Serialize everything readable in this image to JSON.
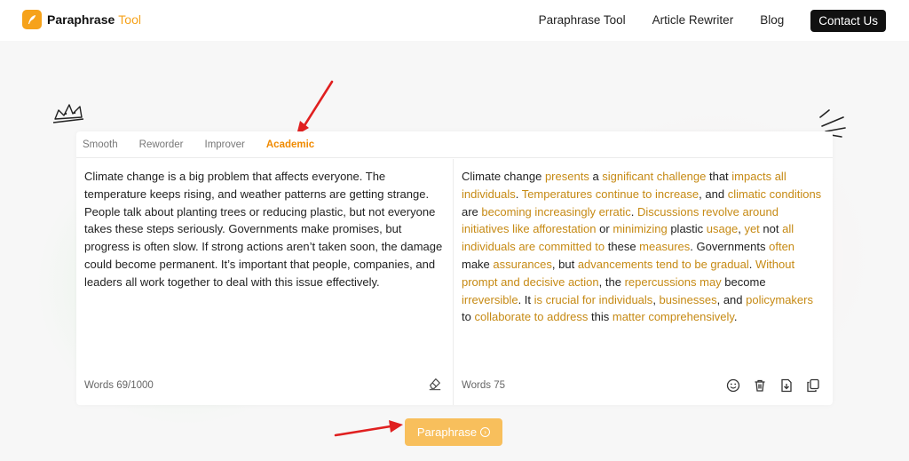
{
  "header": {
    "logo_icon": "feather-pen-icon",
    "logo_name": "Paraphrase",
    "logo_accent": "Tool",
    "nav": [
      "Paraphrase Tool",
      "Article Rewriter",
      "Blog"
    ],
    "contact_label": "Contact Us"
  },
  "tabs": [
    {
      "label": "Smooth",
      "active": false
    },
    {
      "label": "Reworder",
      "active": false
    },
    {
      "label": "Improver",
      "active": false
    },
    {
      "label": "Academic",
      "active": true
    }
  ],
  "input": {
    "text": "Climate change is a big problem that affects everyone. The temperature keeps rising, and weather patterns are getting strange. People talk about planting trees or reducing plastic, but not everyone takes these steps seriously. Governments make promises, but progress is often slow. If strong actions aren’t taken soon, the damage could become permanent. It’s important that people, companies, and leaders all work together to deal with this issue effectively.",
    "word_count": "Words 69/1000"
  },
  "output": {
    "segments": [
      {
        "t": "Climate change ",
        "h": false
      },
      {
        "t": "presents",
        "h": true
      },
      {
        "t": " a ",
        "h": false
      },
      {
        "t": "significant challenge",
        "h": true
      },
      {
        "t": " that ",
        "h": false
      },
      {
        "t": "impacts all individuals",
        "h": true
      },
      {
        "t": ". ",
        "h": false
      },
      {
        "t": "Temperatures continue to increase",
        "h": true
      },
      {
        "t": ", and ",
        "h": false
      },
      {
        "t": "climatic conditions",
        "h": true
      },
      {
        "t": " are ",
        "h": false
      },
      {
        "t": "becoming increasingly erratic",
        "h": true
      },
      {
        "t": ". ",
        "h": false
      },
      {
        "t": "Discussions revolve around initiatives like afforestation",
        "h": true
      },
      {
        "t": " or ",
        "h": false
      },
      {
        "t": "minimizing",
        "h": true
      },
      {
        "t": " plastic ",
        "h": false
      },
      {
        "t": "usage",
        "h": true
      },
      {
        "t": ", ",
        "h": false
      },
      {
        "t": "yet",
        "h": true
      },
      {
        "t": " not ",
        "h": false
      },
      {
        "t": "all individuals are committed to",
        "h": true
      },
      {
        "t": " these ",
        "h": false
      },
      {
        "t": "measures",
        "h": true
      },
      {
        "t": ". Governments ",
        "h": false
      },
      {
        "t": "often",
        "h": true
      },
      {
        "t": " make ",
        "h": false
      },
      {
        "t": "assurances",
        "h": true
      },
      {
        "t": ", but ",
        "h": false
      },
      {
        "t": "advancements tend to be gradual",
        "h": true
      },
      {
        "t": ". ",
        "h": false
      },
      {
        "t": "Without prompt and decisive action",
        "h": true
      },
      {
        "t": ", the ",
        "h": false
      },
      {
        "t": "repercussions may",
        "h": true
      },
      {
        "t": " become ",
        "h": false
      },
      {
        "t": "irreversible",
        "h": true
      },
      {
        "t": ". It ",
        "h": false
      },
      {
        "t": "is crucial for individuals",
        "h": true
      },
      {
        "t": ", ",
        "h": false
      },
      {
        "t": "businesses",
        "h": true
      },
      {
        "t": ", and ",
        "h": false
      },
      {
        "t": "policymakers",
        "h": true
      },
      {
        "t": " to ",
        "h": false
      },
      {
        "t": "collaborate to address",
        "h": true
      },
      {
        "t": " this ",
        "h": false
      },
      {
        "t": "matter comprehensively",
        "h": true
      },
      {
        "t": ".",
        "h": false
      }
    ],
    "word_count": "Words 75",
    "tools": [
      "smiley-icon",
      "trash-icon",
      "download-icon",
      "copy-icon"
    ]
  },
  "eraser_icon": "eraser-icon",
  "paraphrase_label": "Paraphrase",
  "colors": {
    "accent": "#f6a21a",
    "highlight": "#c68a14",
    "button": "#f8bf5c",
    "arrow": "#e02020"
  }
}
